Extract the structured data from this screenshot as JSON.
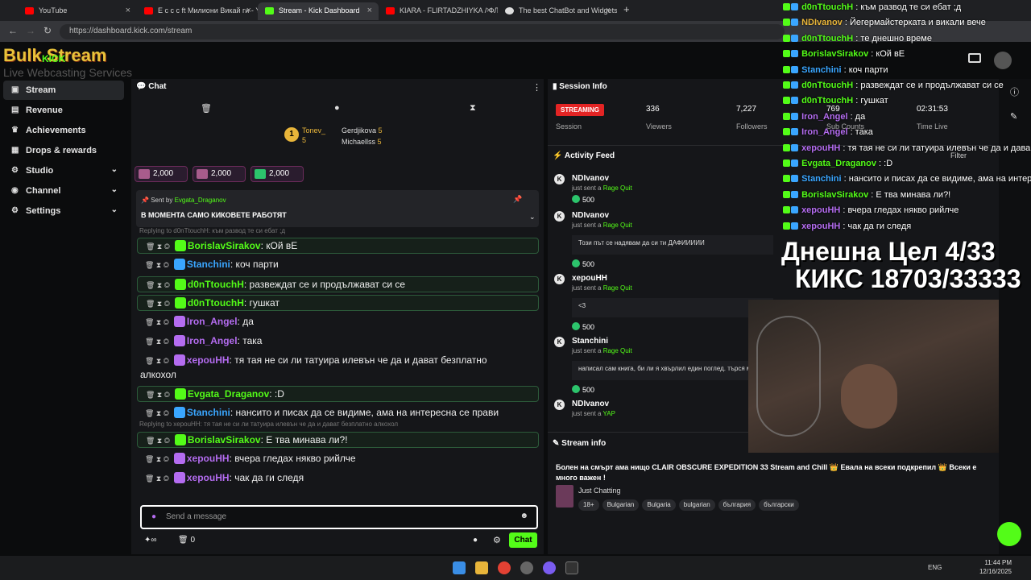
{
  "browser": {
    "tabs": [
      {
        "title": "YouTube",
        "color": "#ff0000"
      },
      {
        "title": "E c c c ft Милиони Викай ги - Y",
        "color": "#ff0000"
      },
      {
        "title": "Stream - Kick Dashboard",
        "color": "#53fc18"
      },
      {
        "title": "KIARA - FLIRTADZHIYKA / ФЛИ",
        "color": "#ff0000"
      },
      {
        "title": "The best ChatBot and Widgets",
        "color": "#dddddd"
      }
    ],
    "url": "https://dashboard.kick.com/stream"
  },
  "branding": {
    "logo": "Bulk Stream",
    "subtitle": "Live Webcasting Services",
    "kick": "KICK"
  },
  "sidebar": {
    "items": [
      {
        "label": "Stream",
        "icon": "video-icon"
      },
      {
        "label": "Revenue",
        "icon": "wallet-icon"
      },
      {
        "label": "Achievements",
        "icon": "trophy-icon"
      },
      {
        "label": "Drops & rewards",
        "icon": "gift-icon"
      },
      {
        "label": "Studio",
        "icon": "studio-icon"
      },
      {
        "label": "Channel",
        "icon": "channel-icon"
      },
      {
        "label": "Settings",
        "icon": "gear-icon"
      }
    ]
  },
  "chat": {
    "title": "Chat",
    "leaderboard": {
      "first": {
        "name": "Tonev_",
        "count": "5"
      },
      "second": {
        "name": "Gerdjikova",
        "count": "5"
      },
      "third": {
        "name": "Michaellss",
        "count": "5"
      }
    },
    "gifts": [
      "2,000",
      "2,000",
      "2,000"
    ],
    "pinned": {
      "sent_by_label": "Sent by",
      "sender": "Evgata_Draganov",
      "text": "В МОМЕНТА САМО КИКОВЕТЕ РАБОТЯТ"
    },
    "reply_1": "Replying to d0nTtouchH: към развод те си ебат ;д",
    "reply_2": "Replying to xepouHH: тя тая не си ли татуира илевън че да и дават безплатно алкохол",
    "messages": [
      {
        "user": "BorislavSirakov",
        "text": ": кОй вЕ",
        "color": "#53fc18"
      },
      {
        "user": "Stanchini",
        "text": ": коч парти",
        "color": "#3aa6ff"
      },
      {
        "user": "d0nTtouchH",
        "text": ": развеждат се и продължават си се",
        "color": "#53fc18"
      },
      {
        "user": "d0nTtouchH",
        "text": ": гушкат",
        "color": "#53fc18"
      },
      {
        "user": "Iron_Angel",
        "text": ": да",
        "color": "#b46cf0"
      },
      {
        "user": "Iron_Angel",
        "text": ": така",
        "color": "#b46cf0"
      },
      {
        "user": "xepouHH",
        "text": ": тя тая не си ли татуира илевън че да и дават безплатно",
        "color": "#b46cf0"
      },
      {
        "user": "",
        "text": "алкохол",
        "color": "#ffffff"
      },
      {
        "user": "Evgata_Draganov",
        "text": ": :D",
        "color": "#53fc18"
      },
      {
        "user": "Stanchini",
        "text": ": нансито и писах да се видиме, ама на интересна се прави",
        "color": "#3aa6ff"
      },
      {
        "user": "BorislavSirakov",
        "text": ": Е тва минава ли?!",
        "color": "#53fc18"
      },
      {
        "user": "xepouHH",
        "text": ": вчера гледах някво рийлче",
        "color": "#b46cf0"
      },
      {
        "user": "xepouHH",
        "text": ": чак да ги следя",
        "color": "#b46cf0"
      }
    ],
    "input_placeholder": "Send a message",
    "count": "0",
    "send_label": "Chat"
  },
  "session": {
    "title": "Session Info",
    "status": "STREAMING",
    "session_label": "Session",
    "viewers": "336",
    "viewers_label": "Viewers",
    "followers": "7,227",
    "followers_label": "Followers",
    "subs": "769",
    "subs_label": "Sub Counts",
    "time": "02:31:53",
    "time_label": "Time Live"
  },
  "activity": {
    "title": "Activity Feed",
    "filter": "Filter",
    "items": [
      {
        "user": "NDIvanov",
        "action": "just sent a",
        "reward": "Rage Quit",
        "amount": "500",
        "quote": ""
      },
      {
        "user": "NDIvanov",
        "action": "just sent a",
        "reward": "Rage Quit",
        "amount": "500",
        "quote": "Този път се надявам да си ти ДАФИИИИИ"
      },
      {
        "user": "xepouHH",
        "action": "just sent a",
        "reward": "Rage Quit",
        "amount": "500",
        "quote": "<3"
      },
      {
        "user": "Stanchini",
        "action": "just sent a",
        "reward": "Rage Quit",
        "amount": "500",
        "quote": "написал сам книга, би ли я хвърлил един поглед. търся м"
      },
      {
        "user": "NDIvanov",
        "action": "just sent a",
        "reward": "YAP",
        "amount": "",
        "quote": ""
      }
    ]
  },
  "stream_info": {
    "title": "Stream info",
    "stream_title": "Болен на смърт ама нищо CLAIR OBSCURE EXPEDITION 33 Stream and Chill 👑 Евала на всеки подкрепил 👑 Всеки е много важен !",
    "category": "Just Chatting",
    "tags": [
      "18+",
      "Bulgarian",
      "Bulgaria",
      "bulgarian",
      "българия",
      "български"
    ]
  },
  "overlay_chat": [
    {
      "user": "d0nTtouchH",
      "text": " : към развод те си ебат ;д",
      "color": "#53fc18"
    },
    {
      "user": "NDIvanov",
      "text": " : Йегермайстерката и викали вече",
      "color": "#e8b53a"
    },
    {
      "user": "d0nTtouchH",
      "text": " : те днешно време",
      "color": "#53fc18"
    },
    {
      "user": "BorislavSirakov",
      "text": " : кОй вЕ",
      "color": "#53fc18"
    },
    {
      "user": "Stanchini",
      "text": " : коч парти",
      "color": "#3aa6ff"
    },
    {
      "user": "d0nTtouchH",
      "text": " : развеждат се и продължават си се",
      "color": "#53fc18"
    },
    {
      "user": "d0nTtouchH",
      "text": " : гушкат",
      "color": "#53fc18"
    },
    {
      "user": "Iron_Angel",
      "text": " : да",
      "color": "#b46cf0"
    },
    {
      "user": "Iron_Angel",
      "text": " : така",
      "color": "#b46cf0"
    },
    {
      "user": "xepouHH",
      "text": " : тя тая не си ли татуира илевън че да и дава",
      "color": "#b46cf0"
    },
    {
      "user": "Evgata_Draganov",
      "text": " : :D",
      "color": "#53fc18"
    },
    {
      "user": "Stanchini",
      "text": " : нансито и писах да се видиме, ама на интерес",
      "color": "#3aa6ff"
    },
    {
      "user": "BorislavSirakov",
      "text": " : Е тва минава ли?!",
      "color": "#53fc18"
    },
    {
      "user": "xepouHH",
      "text": " : вчера гледах някво рийлче",
      "color": "#b46cf0"
    },
    {
      "user": "xepouHH",
      "text": " : чак да ги следя",
      "color": "#b46cf0"
    }
  ],
  "goal": {
    "line1": "Днешна Цел 4/33",
    "line2": "КИКС 18703/33333"
  },
  "taskbar": {
    "lang": "ENG",
    "time": "11:44 PM",
    "date": "12/16/2025"
  }
}
